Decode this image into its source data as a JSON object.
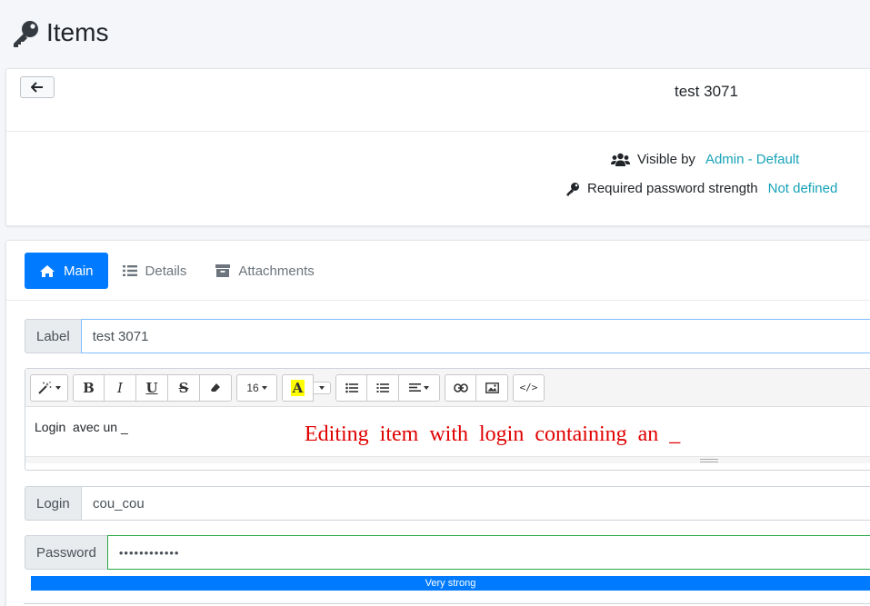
{
  "page": {
    "title": "Items",
    "icon": "key-icon"
  },
  "item_card": {
    "back_icon": "arrow-left-icon",
    "item_title": "test 3071",
    "visible_by": {
      "icon": "users-icon",
      "label": "Visible by",
      "value": "Admin - Default"
    },
    "required_strength": {
      "icon": "key-icon",
      "label": "Required password strength",
      "value": "Not defined"
    }
  },
  "tabs": [
    {
      "label": "Main",
      "icon": "home-icon",
      "active": true
    },
    {
      "label": "Details",
      "icon": "list-icon",
      "active": false
    },
    {
      "label": "Attachments",
      "icon": "archive-icon",
      "active": false
    }
  ],
  "form": {
    "label": {
      "addon": "Label",
      "value": "test 3071"
    },
    "editor": {
      "toolbar": {
        "magic": "magic-wand-icon",
        "bold": "B",
        "italic": "I",
        "underline": "U",
        "strike": "S",
        "eraser": "eraser-icon",
        "font_size": "16",
        "color": "A",
        "ul": "unordered-list-icon",
        "ol": "ordered-list-icon",
        "align": "align-left-icon",
        "link": "link-icon",
        "image": "image-icon",
        "code": "</>"
      },
      "content": "Login  avec un _"
    },
    "login": {
      "addon": "Login",
      "value": "cou_cou"
    },
    "password": {
      "addon": "Password",
      "value": "••••••••••••"
    },
    "strength": {
      "label": "Very strong",
      "level": 1.0
    }
  },
  "annotation": {
    "text": "Editing item with login containing an _"
  },
  "colors": {
    "primary": "#007bff",
    "info": "#17a2b8",
    "success": "#28a745",
    "annotation": "#e00000"
  }
}
